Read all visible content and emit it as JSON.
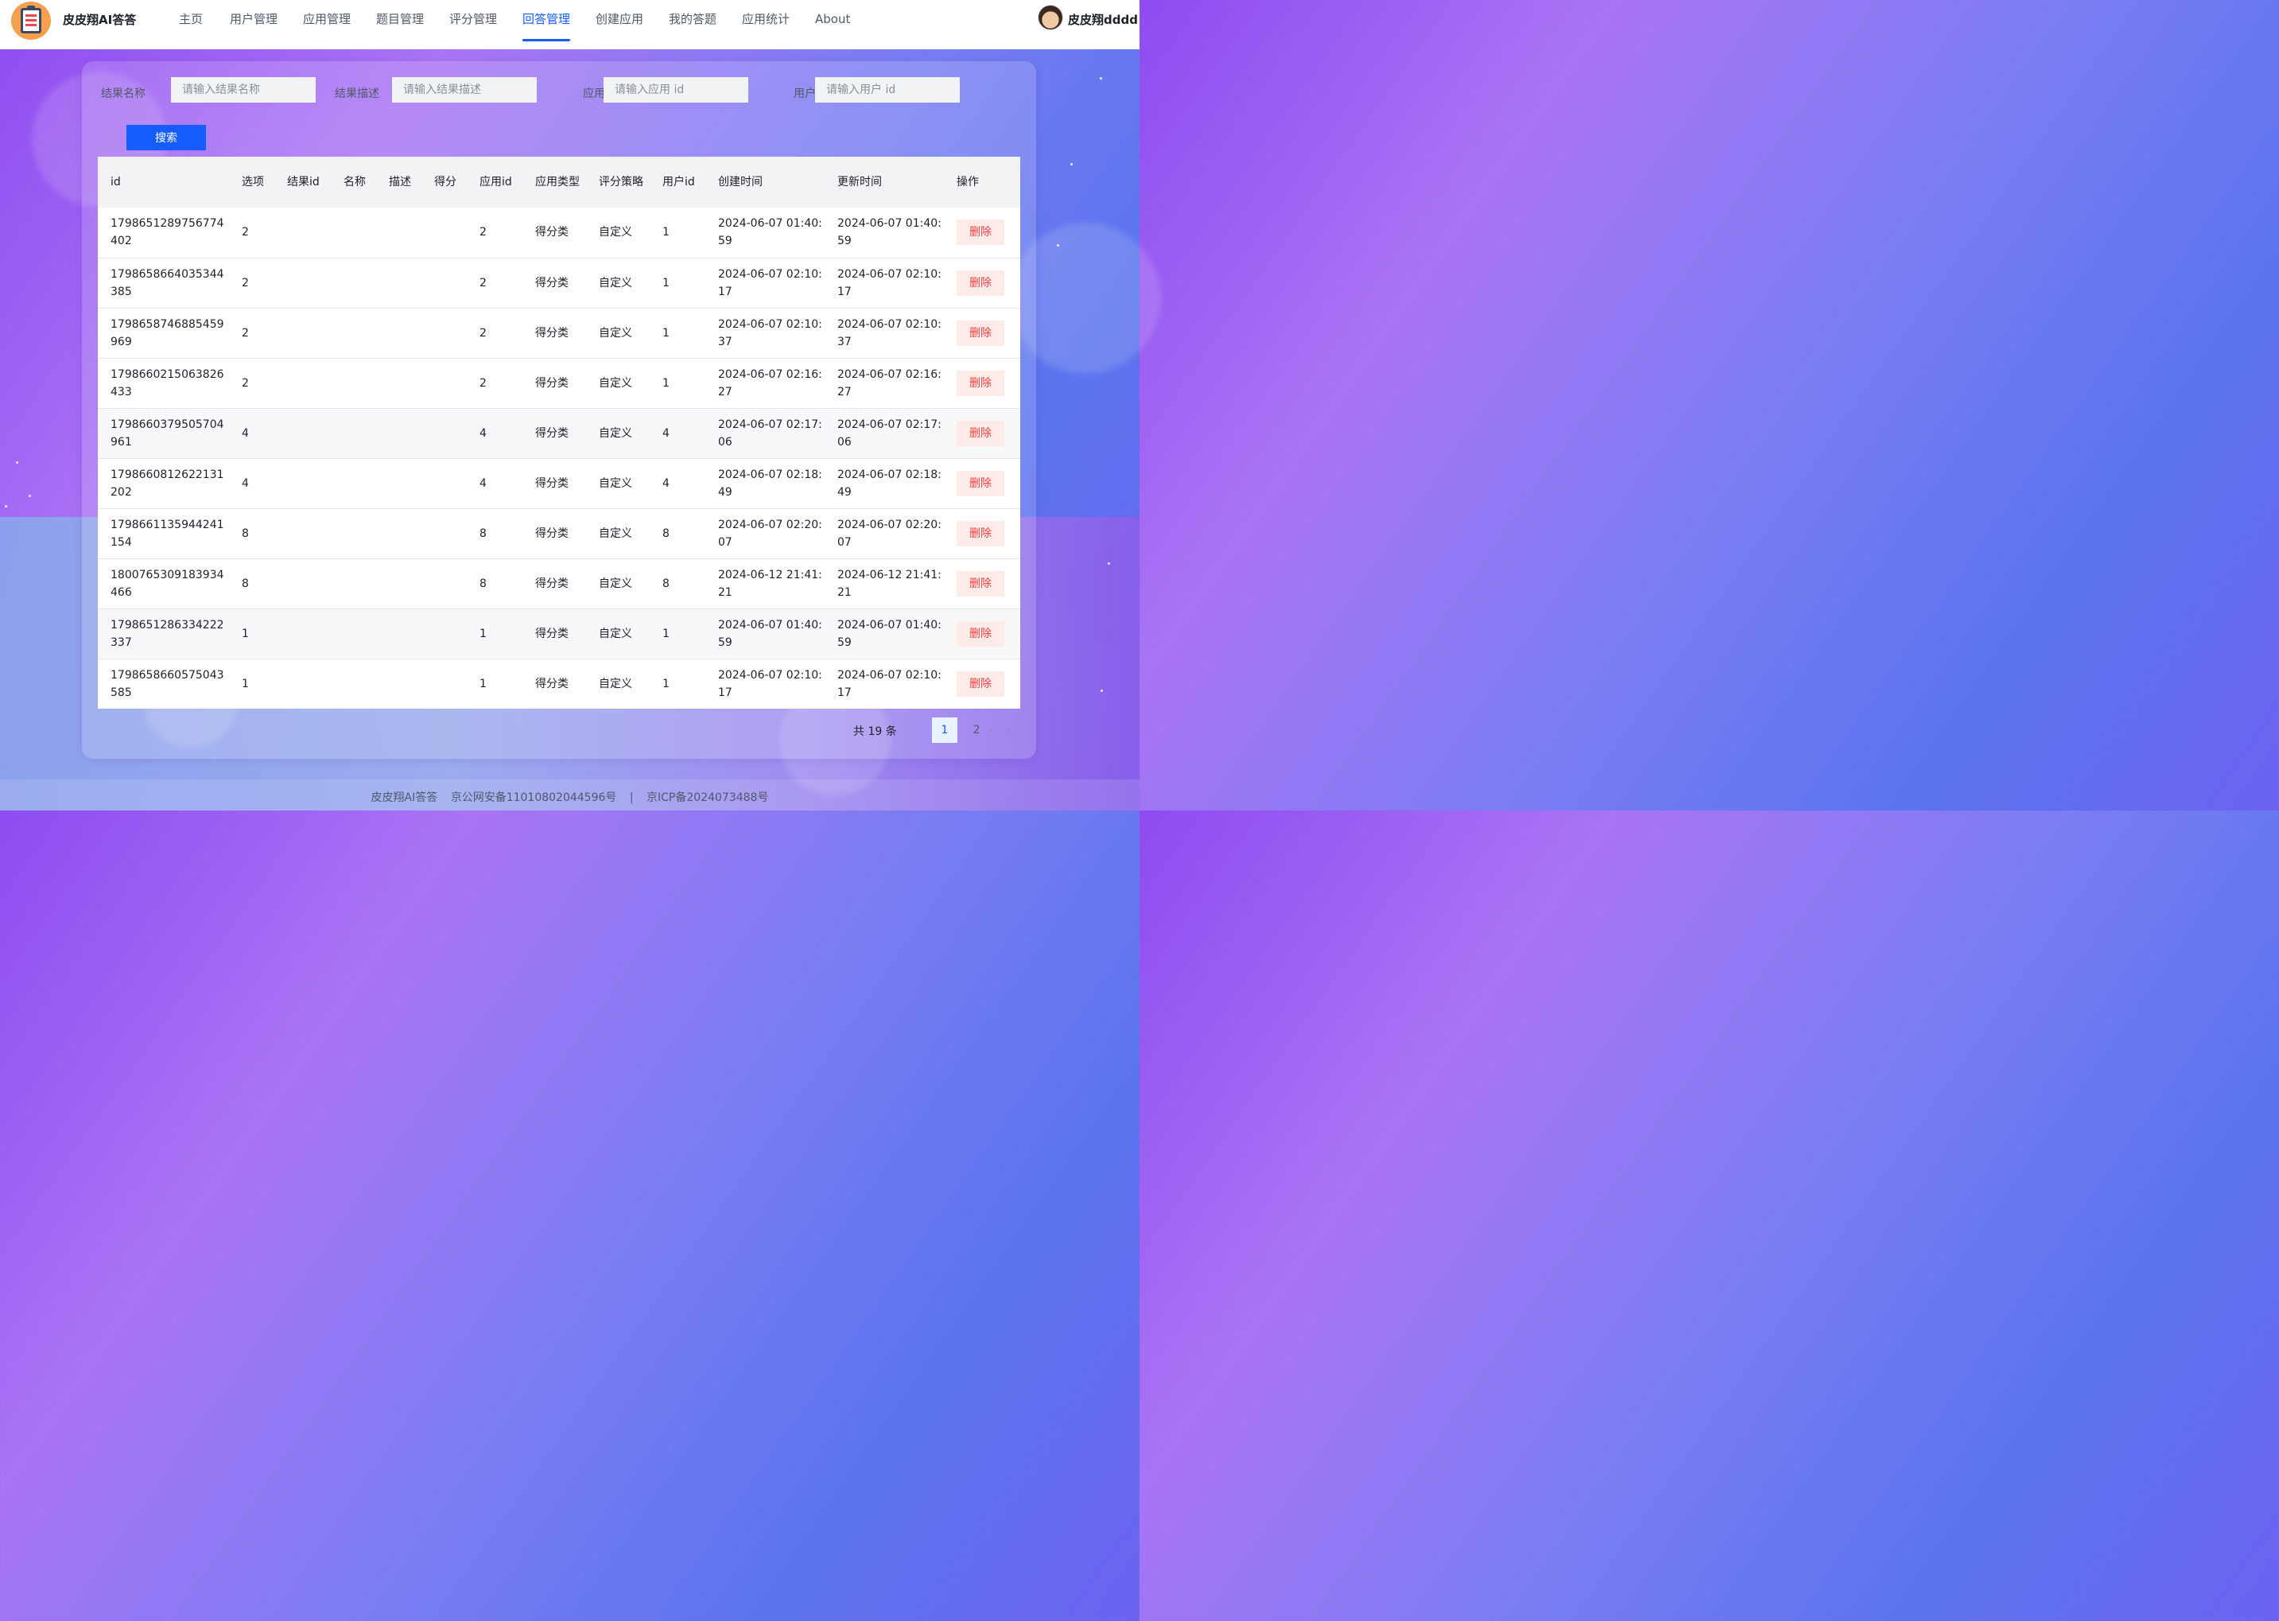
{
  "header": {
    "brand": "皮皮翔AI答答",
    "nav": [
      "主页",
      "用户管理",
      "应用管理",
      "题目管理",
      "评分管理",
      "回答管理",
      "创建应用",
      "我的答题",
      "应用统计",
      "About"
    ],
    "active_index": 5,
    "username": "皮皮翔dddd"
  },
  "search": {
    "fields": [
      {
        "label": "结果名称",
        "placeholder": "请输入结果名称"
      },
      {
        "label": "结果描述",
        "placeholder": "请输入结果描述"
      },
      {
        "label": "应用 id",
        "placeholder": "请输入应用 id"
      },
      {
        "label": "用户 id",
        "placeholder": "请输入用户 id"
      }
    ],
    "button": "搜索"
  },
  "table": {
    "columns": [
      "id",
      "选项",
      "结果id",
      "名称",
      "描述",
      "得分",
      "应用id",
      "应用类型",
      "评分策略",
      "用户id",
      "创建时间",
      "更新时间",
      "操作"
    ],
    "delete_label": "删除",
    "rows": [
      [
        "1798651289756774402",
        "2",
        "",
        "",
        "",
        "",
        "2",
        "得分类",
        "自定义",
        "1",
        "2024-06-07 01:40:59",
        "2024-06-07 01:40:59"
      ],
      [
        "1798658664035344385",
        "2",
        "",
        "",
        "",
        "",
        "2",
        "得分类",
        "自定义",
        "1",
        "2024-06-07 02:10:17",
        "2024-06-07 02:10:17"
      ],
      [
        "1798658746885459969",
        "2",
        "",
        "",
        "",
        "",
        "2",
        "得分类",
        "自定义",
        "1",
        "2024-06-07 02:10:37",
        "2024-06-07 02:10:37"
      ],
      [
        "1798660215063826433",
        "2",
        "",
        "",
        "",
        "",
        "2",
        "得分类",
        "自定义",
        "1",
        "2024-06-07 02:16:27",
        "2024-06-07 02:16:27"
      ],
      [
        "1798660379505704961",
        "4",
        "",
        "",
        "",
        "",
        "4",
        "得分类",
        "自定义",
        "4",
        "2024-06-07 02:17:06",
        "2024-06-07 02:17:06"
      ],
      [
        "1798660812622131202",
        "4",
        "",
        "",
        "",
        "",
        "4",
        "得分类",
        "自定义",
        "4",
        "2024-06-07 02:18:49",
        "2024-06-07 02:18:49"
      ],
      [
        "1798661135944241154",
        "8",
        "",
        "",
        "",
        "",
        "8",
        "得分类",
        "自定义",
        "8",
        "2024-06-07 02:20:07",
        "2024-06-07 02:20:07"
      ],
      [
        "1800765309183934466",
        "8",
        "",
        "",
        "",
        "",
        "8",
        "得分类",
        "自定义",
        "8",
        "2024-06-12 21:41:21",
        "2024-06-12 21:41:21"
      ],
      [
        "1798651286334222337",
        "1",
        "",
        "",
        "",
        "",
        "1",
        "得分类",
        "自定义",
        "1",
        "2024-06-07 01:40:59",
        "2024-06-07 01:40:59"
      ],
      [
        "1798658660575043585",
        "1",
        "",
        "",
        "",
        "",
        "1",
        "得分类",
        "自定义",
        "1",
        "2024-06-07 02:10:17",
        "2024-06-07 02:10:17"
      ]
    ]
  },
  "pagination": {
    "total_text": "共 19 条",
    "pages": [
      "1",
      "2"
    ],
    "current": "1",
    "prev_icon": "‹",
    "next_icon": "›"
  },
  "footer": [
    "皮皮翔AI答答",
    "京公网安备11010802044596号",
    "|",
    "京ICP备2024073488号"
  ],
  "colors": {
    "primary": "#165dff",
    "danger": "#f53f3f",
    "danger_bg": "#ffece8"
  }
}
